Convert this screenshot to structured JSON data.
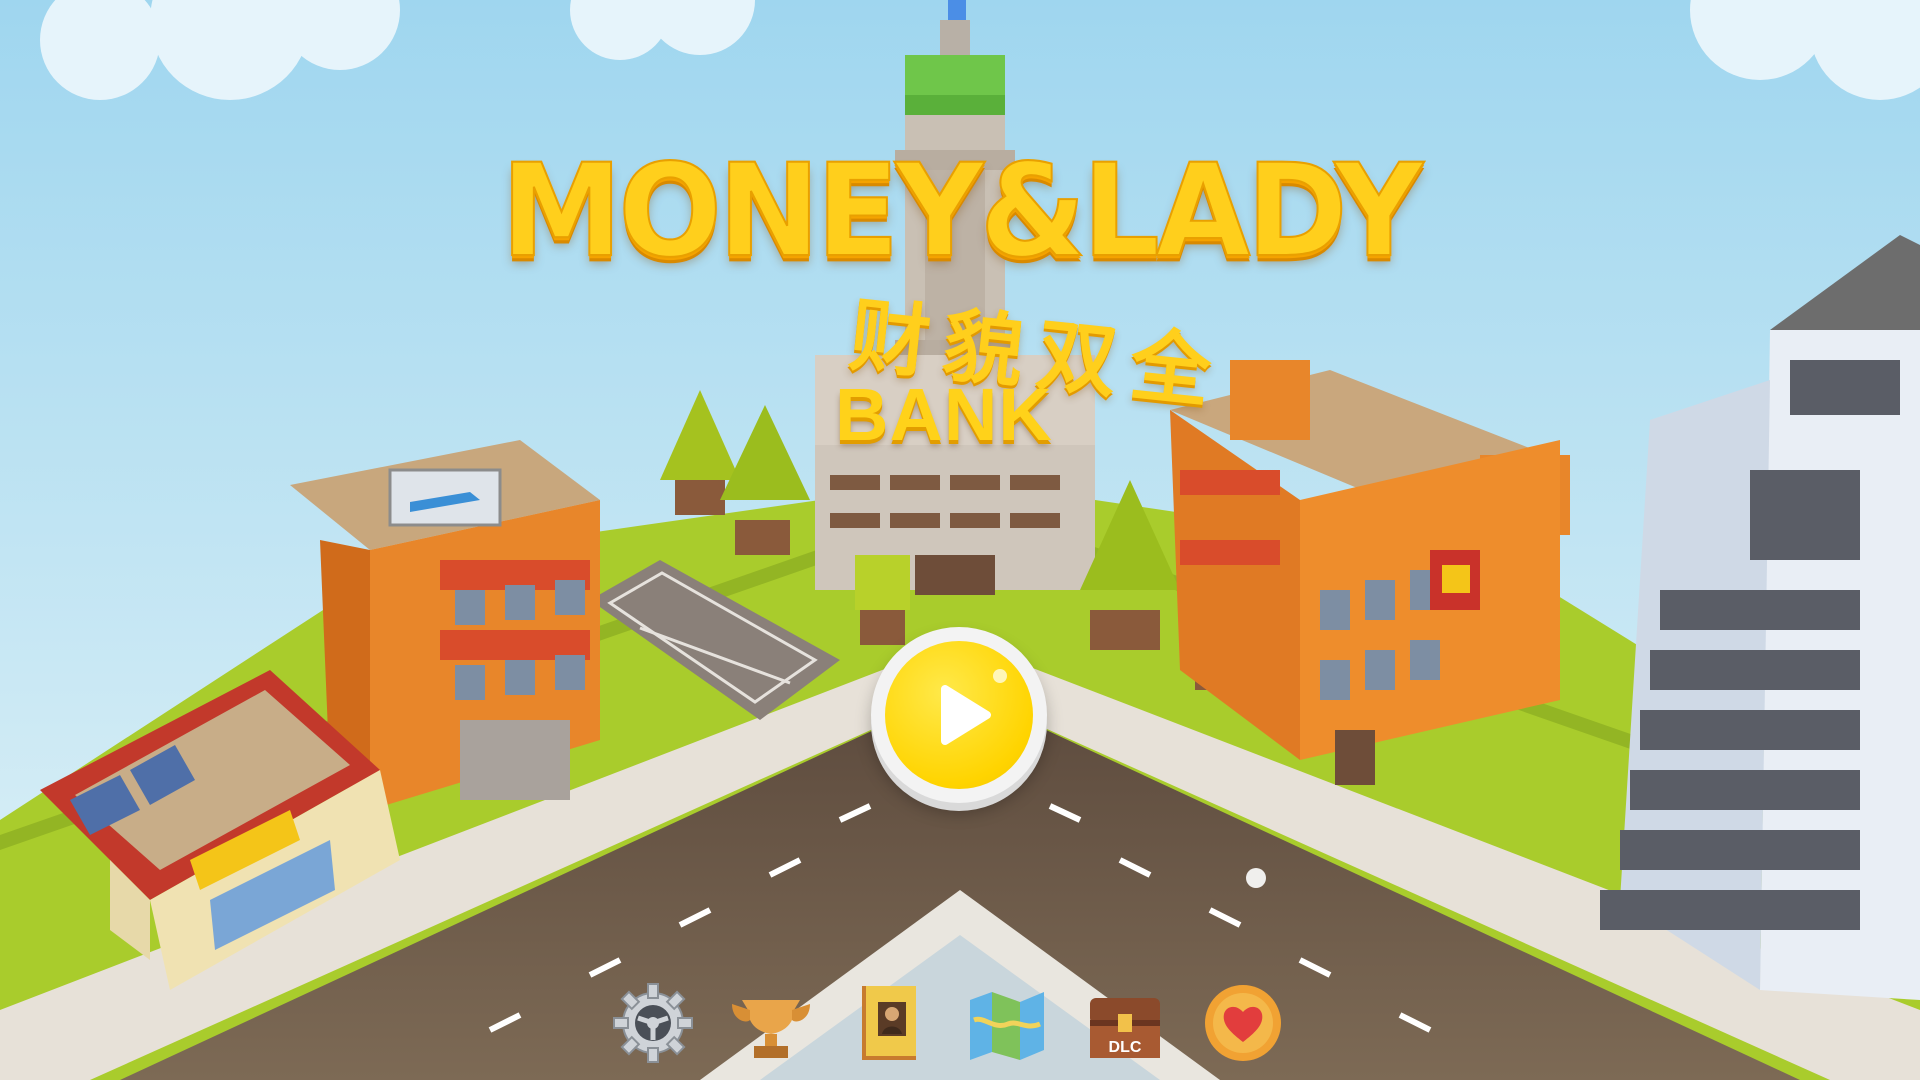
{
  "title": {
    "main": "MONEY&LADY",
    "sub": "财貌双全",
    "bank_sign": "BANK"
  },
  "play_button": {
    "label": "play-icon"
  },
  "menu": [
    {
      "icon": "gear-icon",
      "label": "Settings"
    },
    {
      "icon": "trophy-icon",
      "label": "Achievements"
    },
    {
      "icon": "album-icon",
      "label": "Gallery"
    },
    {
      "icon": "map-icon",
      "label": "Map"
    },
    {
      "icon": "treasure-chest-icon",
      "label": "DLC"
    },
    {
      "icon": "heart-icon",
      "label": "Favorites"
    }
  ],
  "colors": {
    "sky": "#bfe4f3",
    "grass": "#a9cc2c",
    "road": "#6a5443",
    "title_gold": "#ffcf1c",
    "play_yellow": "#ffd400"
  }
}
